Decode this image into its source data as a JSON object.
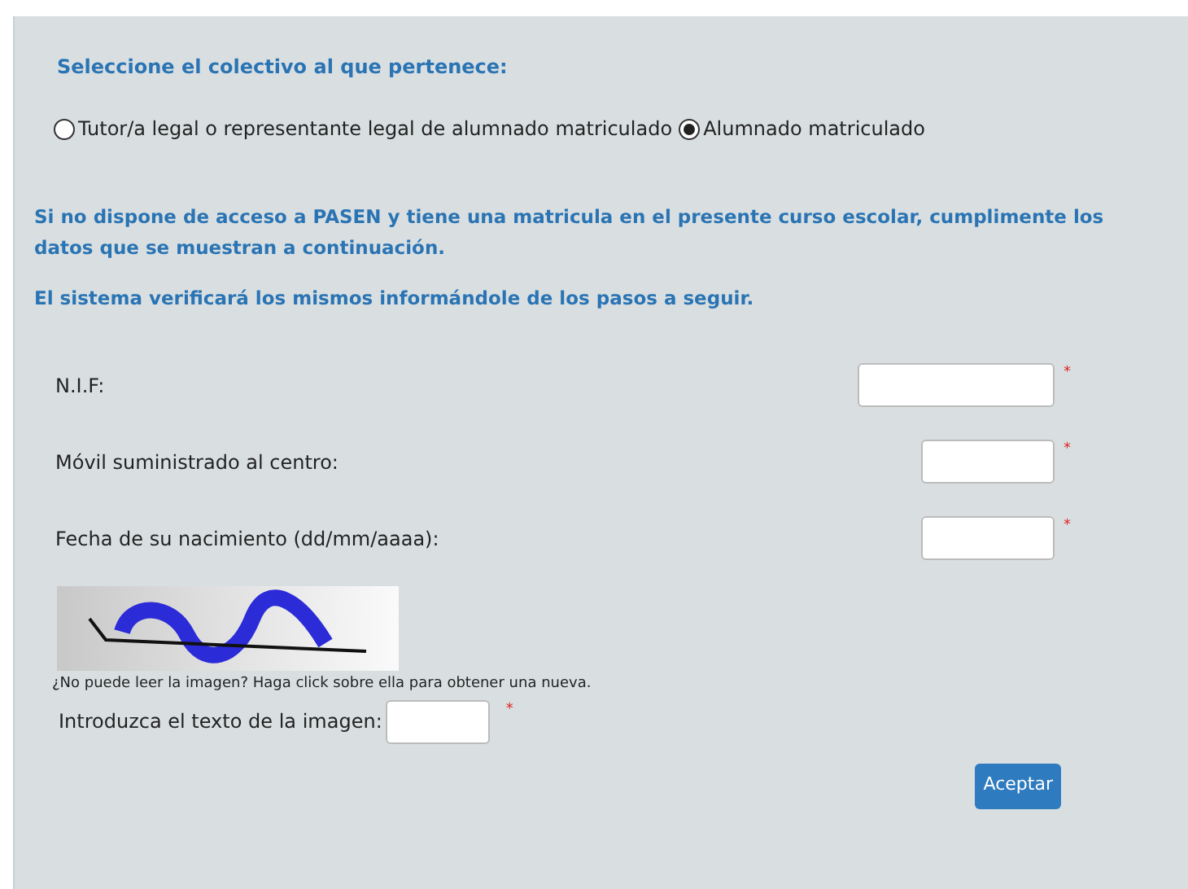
{
  "heading": "Seleccione el colectivo al que pertenece:",
  "options": [
    {
      "label": "Tutor/a legal o representante legal de alumnado matriculado",
      "selected": false
    },
    {
      "label": "Alumnado matriculado",
      "selected": true
    }
  ],
  "info": [
    "Si no dispone de acceso a PASEN y tiene una matricula en el presente curso escolar, cumplimente los datos que se muestran a continuación.",
    "El sistema verificará los mismos informándole de los pasos a seguir."
  ],
  "fields": [
    {
      "label": "N.I.F:",
      "required_mark": "*",
      "kind": "wide"
    },
    {
      "label": "Móvil suministrado al centro:",
      "required_mark": "*",
      "kind": "narrow"
    },
    {
      "label": "Fecha de su nacimiento (dd/mm/aaaa):",
      "required_mark": "*",
      "kind": "narrow"
    }
  ],
  "captcha": {
    "hint": "¿No puede leer la imagen? Haga click sobre ella para obtener una nueva.",
    "label": "Introduzca el texto de la imagen:",
    "required_mark": "*"
  },
  "submit": "Aceptar"
}
